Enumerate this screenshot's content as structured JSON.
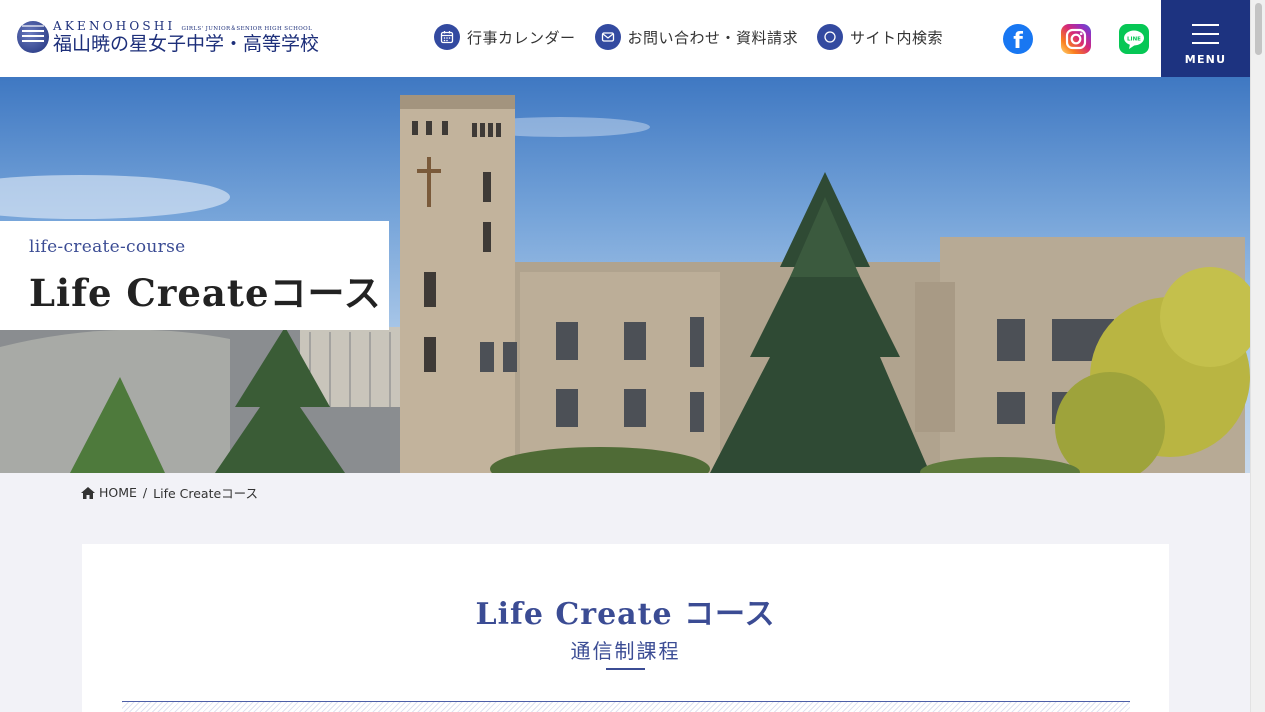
{
  "header": {
    "logo": {
      "en": "AKENOHOSHI",
      "en_sub": "GIRLS' JUNIOR＆SENIOR HIGH SCHOOL",
      "ja": "福山暁の星女子中学・高等学校"
    },
    "nav": [
      {
        "label": "行事カレンダー",
        "icon": "calendar-icon"
      },
      {
        "label": "お問い合わせ・資料請求",
        "icon": "mail-icon"
      },
      {
        "label": "サイト内検索",
        "icon": "search-icon"
      }
    ],
    "social": [
      {
        "name": "facebook",
        "icon": "facebook-icon",
        "color": "#1877f2"
      },
      {
        "name": "instagram",
        "icon": "instagram-icon",
        "color": "#d62976"
      },
      {
        "name": "line",
        "icon": "line-icon",
        "color": "#06c755"
      }
    ],
    "menu_label": "MENU"
  },
  "hero": {
    "slug": "life-create-course",
    "title": "Life Createコース"
  },
  "breadcrumb": {
    "home": "HOME",
    "separator": "/",
    "current": "Life Createコース"
  },
  "content": {
    "title": "Life Create コース",
    "subtitle": "通信制課程"
  },
  "colors": {
    "brand_navy": "#1d3380",
    "accent_blue": "#3b4c94",
    "background": "#f2f2f7"
  }
}
